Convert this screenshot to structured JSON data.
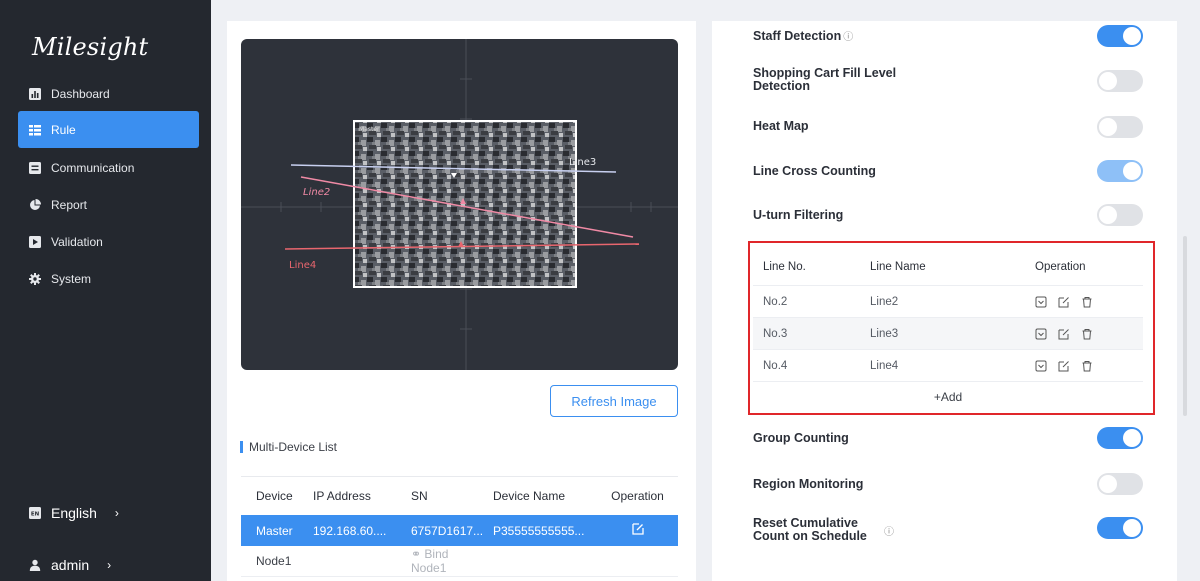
{
  "brand": {
    "logo_text": "Milesight"
  },
  "sidebar": {
    "items": [
      {
        "label": "Dashboard",
        "icon": "bar-chart-icon",
        "active": false
      },
      {
        "label": "Rule",
        "icon": "list-icon",
        "active": true
      },
      {
        "label": "Communication",
        "icon": "message-icon",
        "active": false
      },
      {
        "label": "Report",
        "icon": "pie-chart-icon",
        "active": false
      },
      {
        "label": "Validation",
        "icon": "play-icon",
        "active": false
      },
      {
        "label": "System",
        "icon": "gear-icon",
        "active": false
      }
    ],
    "language": {
      "badge": "EN",
      "label": "English"
    },
    "user": {
      "label": "admin"
    }
  },
  "preview": {
    "overlay_label": "Master",
    "lines": [
      "Line3",
      "Line2",
      "Line4"
    ],
    "refresh_label": "Refresh Image"
  },
  "multi_device": {
    "title": "Multi-Device List",
    "columns": [
      "Device",
      "IP Address",
      "SN",
      "Device Name",
      "Operation"
    ],
    "master": {
      "device": "Master",
      "ip": "192.168.60....",
      "sn": "6757D1617...",
      "name": "P35555555555..."
    },
    "node": {
      "device": "Node1",
      "bind_label": "Bind Node1"
    }
  },
  "features": {
    "staff_detection": "Staff Detection",
    "cart_fill": "Shopping Cart Fill Level Detection",
    "heat_map": "Heat Map",
    "line_cross": "Line Cross Counting",
    "uturn": "U-turn Filtering",
    "group_counting": "Group Counting",
    "region_monitoring": "Region Monitoring",
    "reset_cumulative": "Reset Cumulative Count on Schedule"
  },
  "toggles": {
    "staff_detection": true,
    "cart_fill": false,
    "heat_map": false,
    "line_cross": true,
    "uturn": false,
    "group_counting": true,
    "region_monitoring": false,
    "reset_cumulative": true
  },
  "line_table": {
    "columns": [
      "Line No.",
      "Line Name",
      "Operation"
    ],
    "rows": [
      {
        "no": "No.2",
        "name": "Line2"
      },
      {
        "no": "No.3",
        "name": "Line3"
      },
      {
        "no": "No.4",
        "name": "Line4"
      }
    ],
    "add_label": "+Add"
  },
  "colors": {
    "accent": "#3b8ff0",
    "sidebar_bg": "#24282f",
    "highlight_border": "#e0262a",
    "line_blue": "#c8d0f0",
    "line_pink": "#f08aa5",
    "line_red": "#e8666e"
  }
}
